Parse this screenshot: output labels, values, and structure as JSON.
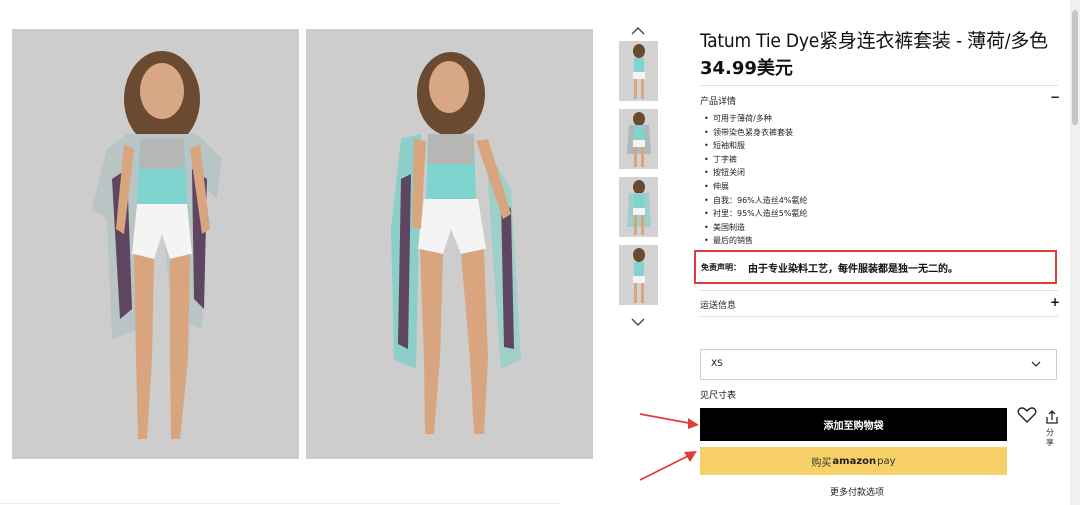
{
  "product": {
    "title": "Tatum Tie Dye紧身连衣裤套装 - 薄荷/多色",
    "price": "34.99美元"
  },
  "details": {
    "label": "产品详情",
    "toggle": "−",
    "items": [
      "可用于薄荷/多种",
      "领带染色紧身衣裤套装",
      "短袖和服",
      "丁字裤",
      "按钮关闭",
      "伸展",
      "自我：96%人造丝4%氨纶",
      "衬里：95%人造丝5%氨纶",
      "美国制造",
      "最后的销售"
    ]
  },
  "disclaimer": {
    "label": "免责声明：",
    "text": "由于专业染料工艺，每件服装都是独一无二的。"
  },
  "shipping": {
    "label": "运送信息",
    "toggle": "+"
  },
  "size": {
    "selected": "XS",
    "size_chart_link": "见尺寸表"
  },
  "actions": {
    "add_to_bag": "添加至购物袋",
    "amazon_prefix": "购买",
    "amazon_brand": "amazon",
    "amazon_suffix": "pay",
    "more_payment": "更多付款选项",
    "share_label": "分享"
  },
  "icons": {
    "up": "chevron-up-icon",
    "down": "chevron-down-icon",
    "heart": "heart-icon",
    "share": "share-icon",
    "select": "chevron-down-icon"
  },
  "colors": {
    "accent_box": "#e03c3c",
    "add_bag_bg": "#000000",
    "amazon_bg": "#f7d167",
    "arrow": "#e03c3c"
  }
}
